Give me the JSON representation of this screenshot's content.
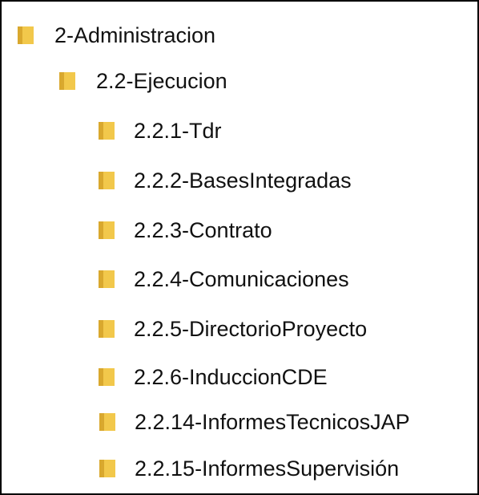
{
  "tree": {
    "folder_icon_color": "#F2C84B",
    "folder_icon_shadow": "#D9A82E",
    "items": [
      {
        "label": "2-Administracion",
        "level": 0,
        "icon": "folder-icon"
      },
      {
        "label": "2.2-Ejecucion",
        "level": 1,
        "icon": "folder-icon"
      },
      {
        "label": "2.2.1-Tdr",
        "level": 2,
        "icon": "folder-icon"
      },
      {
        "label": "2.2.2-BasesIntegradas",
        "level": 2,
        "icon": "folder-icon"
      },
      {
        "label": "2.2.3-Contrato",
        "level": 2,
        "icon": "folder-icon"
      },
      {
        "label": "2.2.4-Comunicaciones",
        "level": 2,
        "icon": "folder-icon"
      },
      {
        "label": "2.2.5-DirectorioProyecto",
        "level": 2,
        "icon": "folder-icon"
      },
      {
        "label": "2.2.6-InduccionCDE",
        "level": 2,
        "icon": "folder-icon"
      },
      {
        "label": "2.2.14-InformesTecnicosJAP",
        "level": 2,
        "icon": "folder-icon"
      },
      {
        "label": "2.2.15-InformesSupervisión",
        "level": 2,
        "icon": "folder-icon"
      }
    ]
  }
}
